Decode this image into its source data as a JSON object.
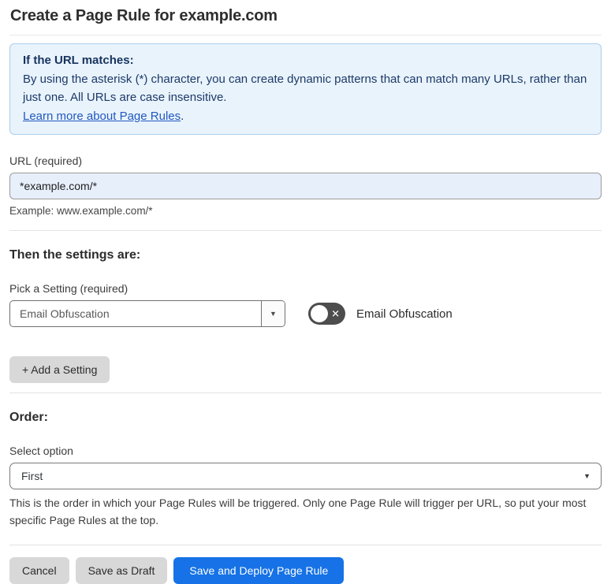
{
  "page": {
    "title": "Create a Page Rule for example.com"
  },
  "info_box": {
    "heading": "If the URL matches:",
    "body": "By using the asterisk (*) character, you can create dynamic patterns that can match many URLs, rather than just one. All URLs are case insensitive.",
    "link_label": "Learn more about Page Rules",
    "link_suffix": "."
  },
  "url_section": {
    "label": "URL (required)",
    "input_value": "*example.com/*",
    "example": "Example: www.example.com/*"
  },
  "settings_section": {
    "heading": "Then the settings are:",
    "picker_label": "Pick a Setting (required)",
    "picker_value": "Email Obfuscation",
    "toggle_label": "Email Obfuscation",
    "toggle_state": "off",
    "add_setting_label": "+ Add a Setting"
  },
  "order_section": {
    "heading": "Order:",
    "label": "Select option",
    "select_value": "First",
    "help_text": "This is the order in which your Page Rules will be triggered. Only one Page Rule will trigger per URL, so put your most specific Page Rules at the top."
  },
  "footer": {
    "cancel_label": "Cancel",
    "save_draft_label": "Save as Draft",
    "save_deploy_label": "Save and Deploy Page Rule"
  },
  "icons": {
    "chevron_down": "▼",
    "toggle_off_x": "✕"
  },
  "colors": {
    "info_bg": "#e9f3fc",
    "info_border": "#abcdec",
    "info_text": "#1c3a68",
    "link": "#2158bf",
    "input_bg": "#e7effb",
    "primary_button": "#1672e6",
    "toggle_off": "#4d4d4d",
    "gray_button": "#d8d8d8"
  }
}
